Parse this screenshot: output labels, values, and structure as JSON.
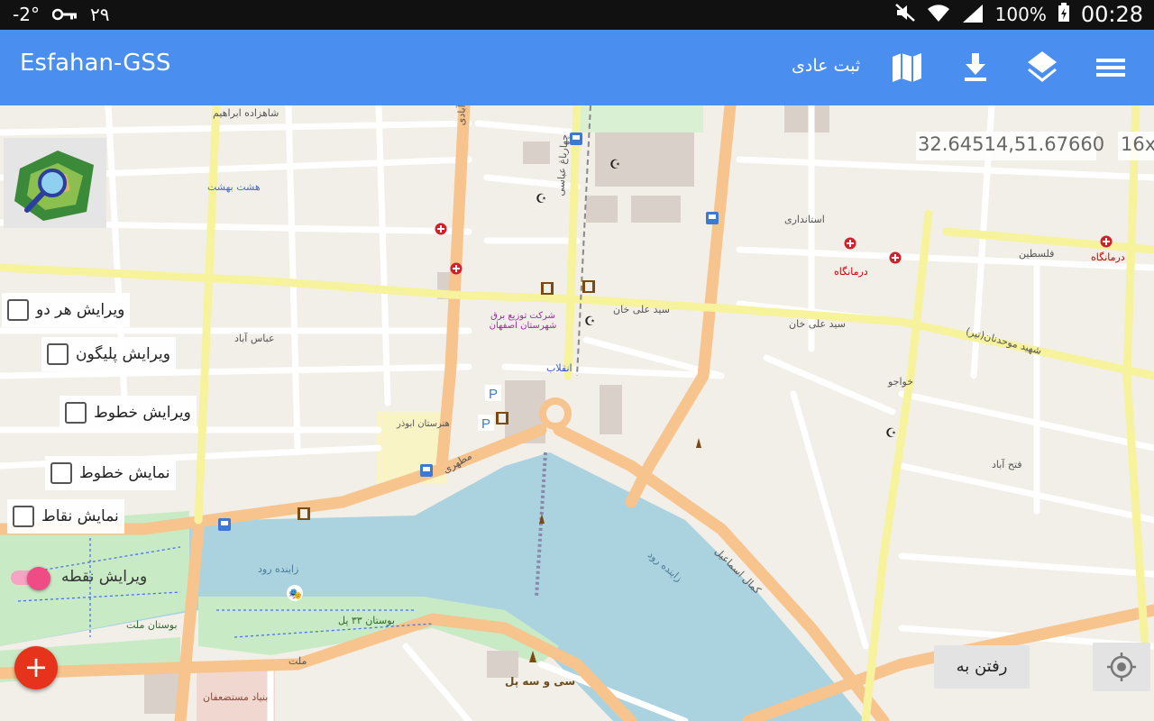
{
  "status_bar": {
    "temperature": "-2°",
    "day": "۲۹",
    "battery": "100%",
    "clock": "00:28"
  },
  "app_bar": {
    "title": "Esfahan-GSS",
    "mode_label": "ثبت عادی",
    "icons": [
      "map-icon",
      "download-icon",
      "layers-icon",
      "menu-icon"
    ],
    "accent_color": "#4a8ef0"
  },
  "map": {
    "coordinates": "32.64514,51.67660",
    "zoom": "16x",
    "labels": {
      "shahzadeh_ebrahim": "شاهزاده ابراهیم",
      "chahar_bagh": "چهارباغ عباسی",
      "shams_abadi": "شمس آبادی",
      "abbas_abad": "عباس آباد",
      "seyed_ali_khan": "سید علی خان",
      "enghelab": "انقلاب",
      "zayandeh_rood_1": "زاینده رود",
      "zayandeh_rood_2": "زاینده رود",
      "kamal_esmaeil": "کمال اسماعیل",
      "si_o_se_pol": "سی و سه پل",
      "bostan_mellat": "بوستان ملت",
      "bostan_33_pol": "بوستان ۳۳ پل",
      "honarestan": "هنرستان ابوذر",
      "sherkat_bargh": "شرکت توزیع برق شهرستان اصفهان",
      "darmangah_1": "درمانگاه",
      "darmangah_2": "درمانگاه",
      "felestin": "فلسطین",
      "moshir": "شهید موحدنان(تیر)",
      "bonyad": "بنیاد مستضعفان",
      "motahari": "مطهری",
      "fath_abad": "فتح آباد",
      "hasht_behesht": "هشت بهشت",
      "ostandari": "استانداری",
      "khaju": "خواجو",
      "mellat": "ملت"
    }
  },
  "layer_toggles": [
    {
      "label": "ویرایش هر دو",
      "checked": false
    },
    {
      "label": "ویرایش پلیگون",
      "checked": false
    },
    {
      "label": "ویرایش خطوط",
      "checked": false
    },
    {
      "label": "نمایش خطوط",
      "checked": false
    },
    {
      "label": "نمایش نقاط",
      "checked": false
    }
  ],
  "point_edit": {
    "label": "ویرایش نقطه",
    "enabled": true,
    "color": "#ef4c85"
  },
  "fab": {
    "label": "+",
    "color": "#e5331c"
  },
  "goto_button": {
    "label": "رفتن به"
  }
}
